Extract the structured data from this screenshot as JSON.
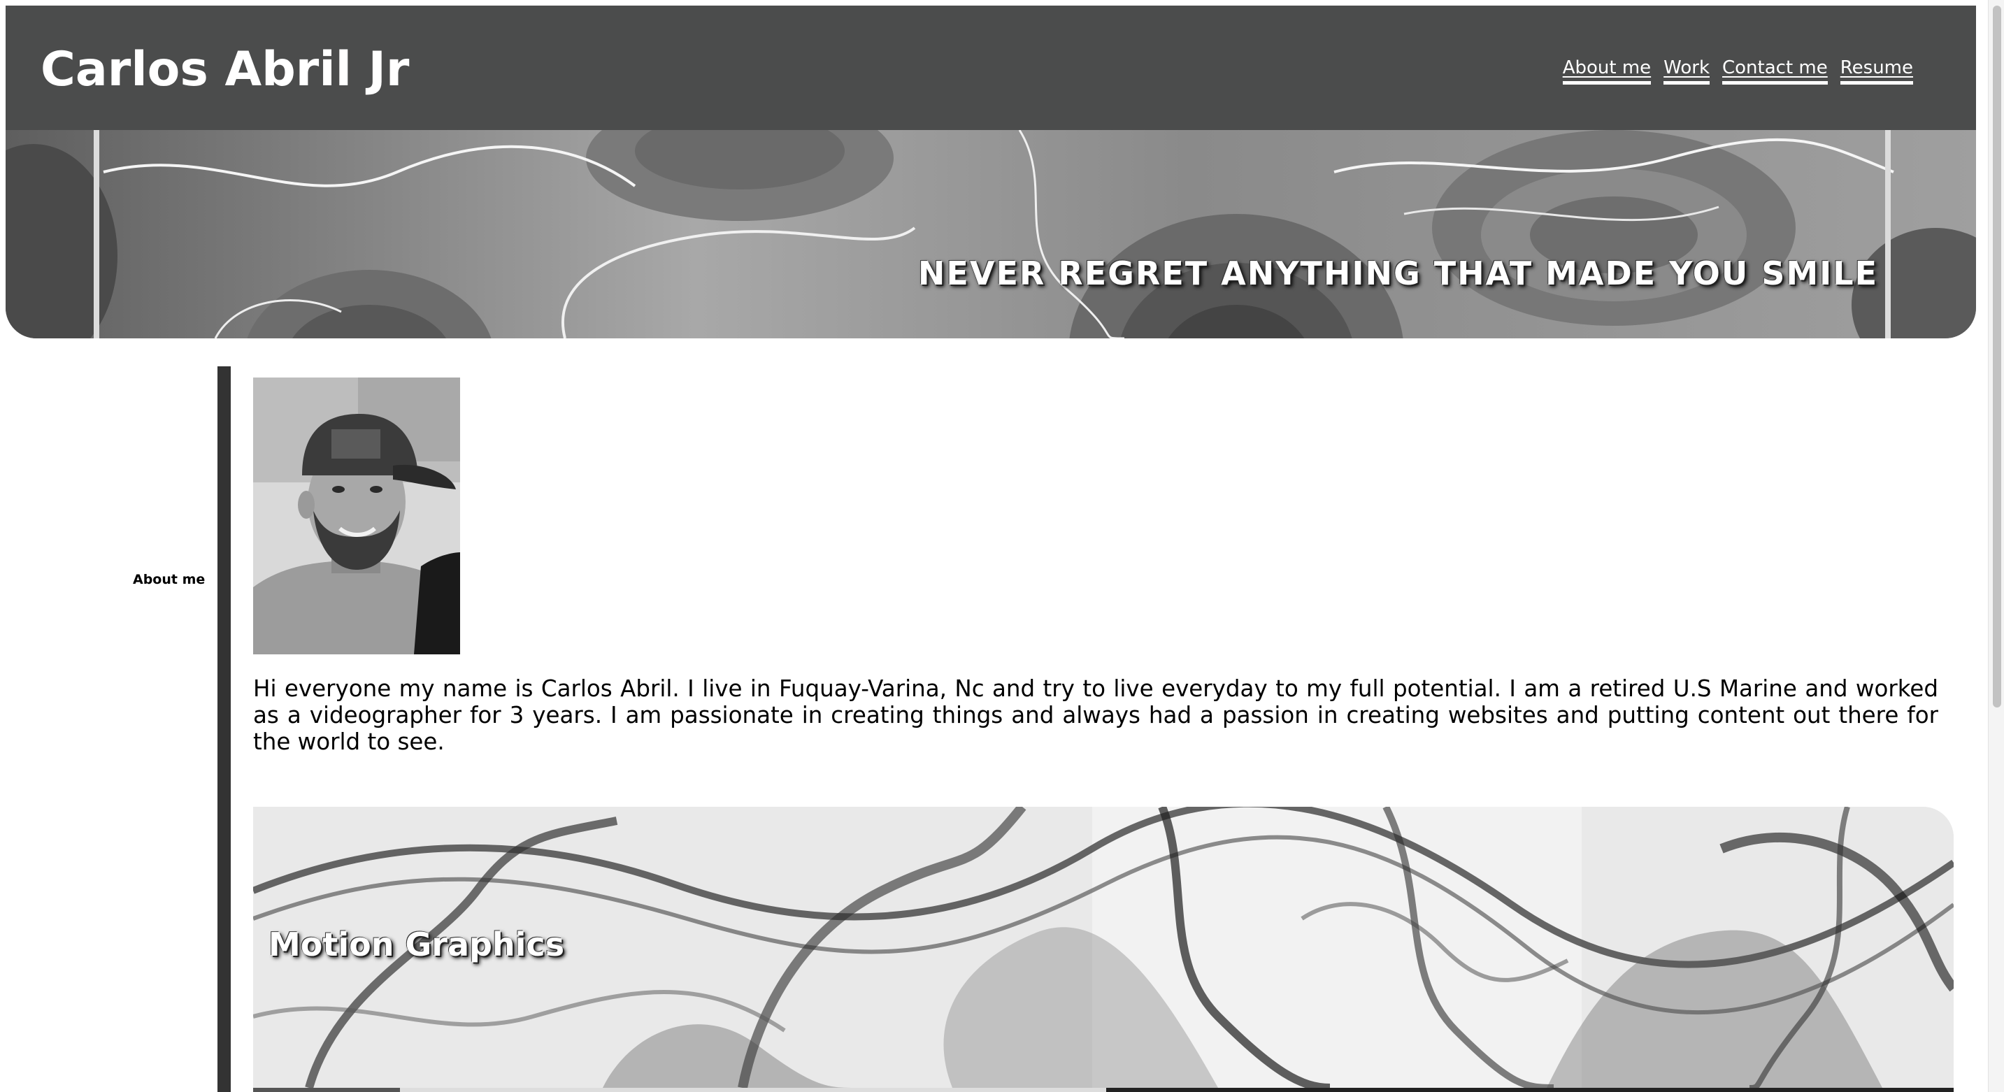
{
  "header": {
    "site_title": "Carlos Abril Jr",
    "nav": [
      {
        "label": "About me"
      },
      {
        "label": "Work"
      },
      {
        "label": "Contact me"
      },
      {
        "label": "Resume"
      }
    ]
  },
  "banner": {
    "tagline": "NEVER REGRET ANYTHING THAT MADE YOU SMILE"
  },
  "sidebar": {
    "section_label": "About me"
  },
  "about": {
    "photo_alt": "Portrait of Carlos Abril",
    "text": "Hi everyone my name is Carlos Abril. I live in Fuquay-Varina, Nc and try to live everyday to my full potential. I am a retired U.S Marine and worked as a videographer for 3 years. I am passionate in creating things and always had a passion in creating websites and putting content out there for the world to see."
  },
  "work": {
    "section_title": "Motion Graphics"
  },
  "colors": {
    "header_bg": "#4b4c4c",
    "sidebar_rule": "#333333",
    "text": "#000000",
    "header_text": "#ffffff"
  }
}
